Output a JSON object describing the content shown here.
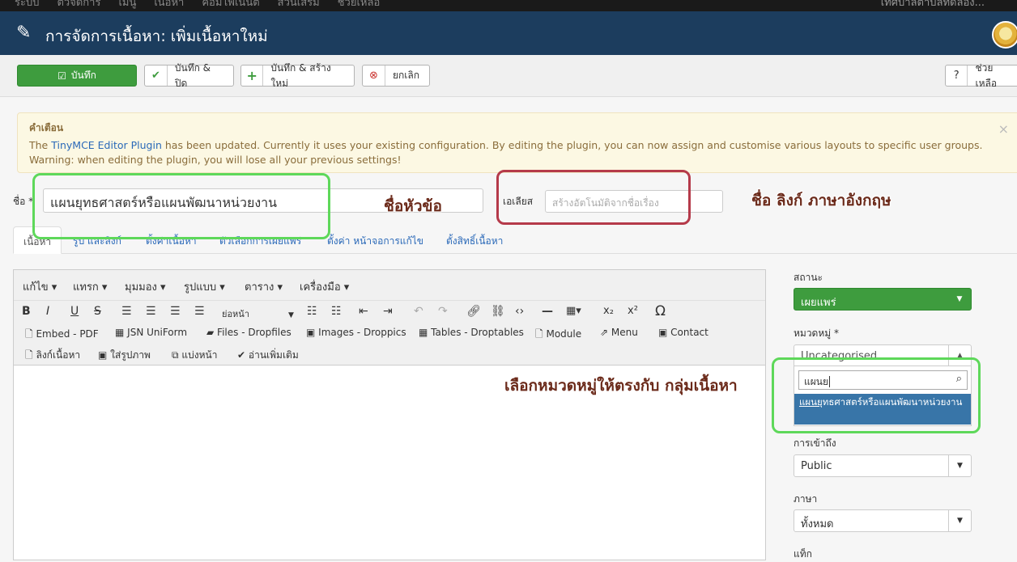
{
  "topbar": {
    "items": [
      "ระบบ",
      "ตัวจัดการ",
      "เมนู",
      "เนื้อหา",
      "คอมโพเนนต์",
      "ส่วนเสริม",
      "ช่วยเหลือ"
    ],
    "right_text": "เทศบาลตำบลทดลอง..."
  },
  "header": {
    "title": "การจัดการเนื้อหา: เพิ่มเนื้อหาใหม่"
  },
  "toolbar": {
    "save": "บันทึก",
    "save_close": "บันทึก & ปิด",
    "save_new": "บันทึก & สร้างใหม่",
    "cancel": "ยกเลิก",
    "help": "ช่วยเหลือ"
  },
  "alert": {
    "heading": "คำเตือน",
    "line1_pre": "The ",
    "line1_link": "TinyMCE Editor Plugin",
    "line1_post": " has been updated. Currently it uses your existing configuration. By editing the plugin, you can now assign and customise various layouts to specific user groups.",
    "line2": "Warning: when editing the plugin, you will lose all your previous settings!"
  },
  "form": {
    "title_label": "ชื่อ *",
    "title_value": "แผนยุทธศาสตร์หรือแผนพัฒนาหน่วยงาน",
    "alias_label": "เอเลียส",
    "alias_placeholder": "สร้างอัตโนมัติจากชื่อเรื่อง"
  },
  "tabs": [
    "เนื้อหา",
    "รูป และลิงก์",
    "ตั้งค่าเนื้อหา",
    "ตัวเลือกการเผยแพร่",
    "ตั้งค่า หน้าจอการแก้ไข",
    "ตั้งสิทธิ์เนื้อหา"
  ],
  "editor": {
    "menus": [
      "แก้ไข ▾",
      "แทรก ▾",
      "มุมมอง ▾",
      "รูปแบบ ▾",
      "ตาราง ▾",
      "เครื่องมือ ▾"
    ],
    "paragraph": "ย่อหน้า",
    "plugins": [
      "Embed - PDF",
      "JSN UniForm",
      "Files - Dropfiles",
      "Images - Droppics",
      "Tables - Droptables",
      "Module",
      "Menu",
      "Contact"
    ],
    "extras": [
      "ลิงก์เนื้อหา",
      "ใส่รูปภาพ",
      "แบ่งหน้า",
      "อ่านเพิ่มเติม"
    ]
  },
  "sidebar": {
    "status_label": "สถานะ",
    "status_value": "เผยแพร่",
    "category_label": "หมวดหมู่ *",
    "category_value": "Uncategorised",
    "category_search": "แผนย",
    "category_result_match": "แผนย",
    "category_result_rest": "ุทธศาสตร์หรือแผนพัฒนาหน่วยงาน",
    "access_label": "การเข้าถึง",
    "access_value": "Public",
    "language_label": "ภาษา",
    "language_value": "ทั้งหมด",
    "tags_label": "แท็ก"
  },
  "annotations": {
    "title": "ชื่อหัวข้อ",
    "alias": "ชื่อ ลิงก์ ภาษาอังกฤษ",
    "category": "เลือกหมวดหมู่ให้ตรงกับ กลุ่มเนื้อหา"
  },
  "colors": {
    "header": "#1c3d5e",
    "save_green": "#3e9c3e",
    "annotation_green": "#5ed85a",
    "annotation_red": "#b53a4a"
  }
}
